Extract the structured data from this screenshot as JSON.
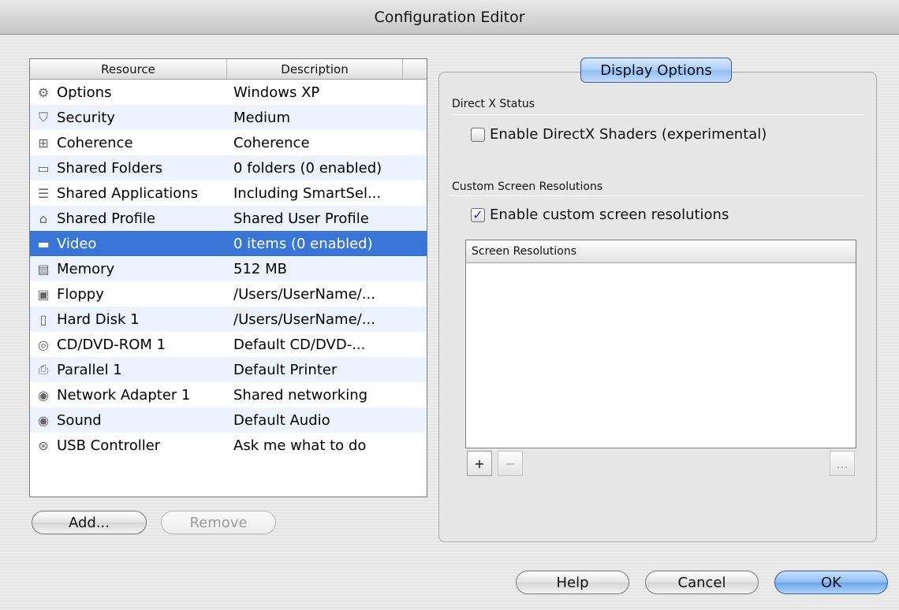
{
  "window": {
    "title": "Configuration Editor"
  },
  "resource_table": {
    "columns": [
      "Resource",
      "Description"
    ],
    "rows": [
      {
        "icon": "gear-icon",
        "glyph": "⚙",
        "resource": "Options",
        "description": "Windows XP"
      },
      {
        "icon": "shield-icon",
        "glyph": "⛉",
        "resource": "Security",
        "description": "Medium"
      },
      {
        "icon": "coherence-icon",
        "glyph": "⊞",
        "resource": "Coherence",
        "description": "Coherence"
      },
      {
        "icon": "shared-folder-icon",
        "glyph": "▭",
        "resource": "Shared Folders",
        "description": "0 folders (0 enabled)"
      },
      {
        "icon": "shared-applications-icon",
        "glyph": "☰",
        "resource": "Shared Applications",
        "description": "Including SmartSel..."
      },
      {
        "icon": "home-icon",
        "glyph": "⌂",
        "resource": "Shared Profile",
        "description": "Shared User Profile"
      },
      {
        "icon": "monitor-icon",
        "glyph": "▬",
        "resource": "Video",
        "description": "0 items (0 enabled)",
        "selected": true
      },
      {
        "icon": "memory-chip-icon",
        "glyph": "▤",
        "resource": "Memory",
        "description": "512 MB"
      },
      {
        "icon": "floppy-disk-icon",
        "glyph": "▣",
        "resource": "Floppy",
        "description": "/Users/UserName/..."
      },
      {
        "icon": "hard-disk-icon",
        "glyph": "▯",
        "resource": "Hard Disk 1",
        "description": "/Users/UserName/..."
      },
      {
        "icon": "cd-dvd-icon",
        "glyph": "◎",
        "resource": "CD/DVD-ROM 1",
        "description": "Default CD/DVD-..."
      },
      {
        "icon": "printer-icon",
        "glyph": "⎙",
        "resource": "Parallel 1",
        "description": "Default Printer"
      },
      {
        "icon": "network-adapter-icon",
        "glyph": "◉",
        "resource": "Network Adapter 1",
        "description": "Shared networking"
      },
      {
        "icon": "speaker-icon",
        "glyph": "◉",
        "resource": "Sound",
        "description": "Default Audio"
      },
      {
        "icon": "usb-icon",
        "glyph": "⊛",
        "resource": "USB Controller",
        "description": "Ask me what to do"
      }
    ]
  },
  "buttons": {
    "add": "Add...",
    "remove": "Remove",
    "help": "Help",
    "cancel": "Cancel",
    "ok": "OK"
  },
  "display_options": {
    "tab_label": "Display Options",
    "directx_section": "Direct X Status",
    "directx_checkbox": {
      "label": "Enable DirectX Shaders (experimental)",
      "checked": false
    },
    "custom_section": "Custom Screen Resolutions",
    "custom_checkbox": {
      "label": "Enable custom screen resolutions",
      "checked": true
    },
    "resolutions_header": "Screen Resolutions",
    "add_symbol": "+",
    "remove_symbol": "−",
    "more_symbol": "..."
  },
  "colors": {
    "selection": "#3875d7",
    "alt_row": "#edf3fe",
    "default_button": "#6aa4ec"
  }
}
